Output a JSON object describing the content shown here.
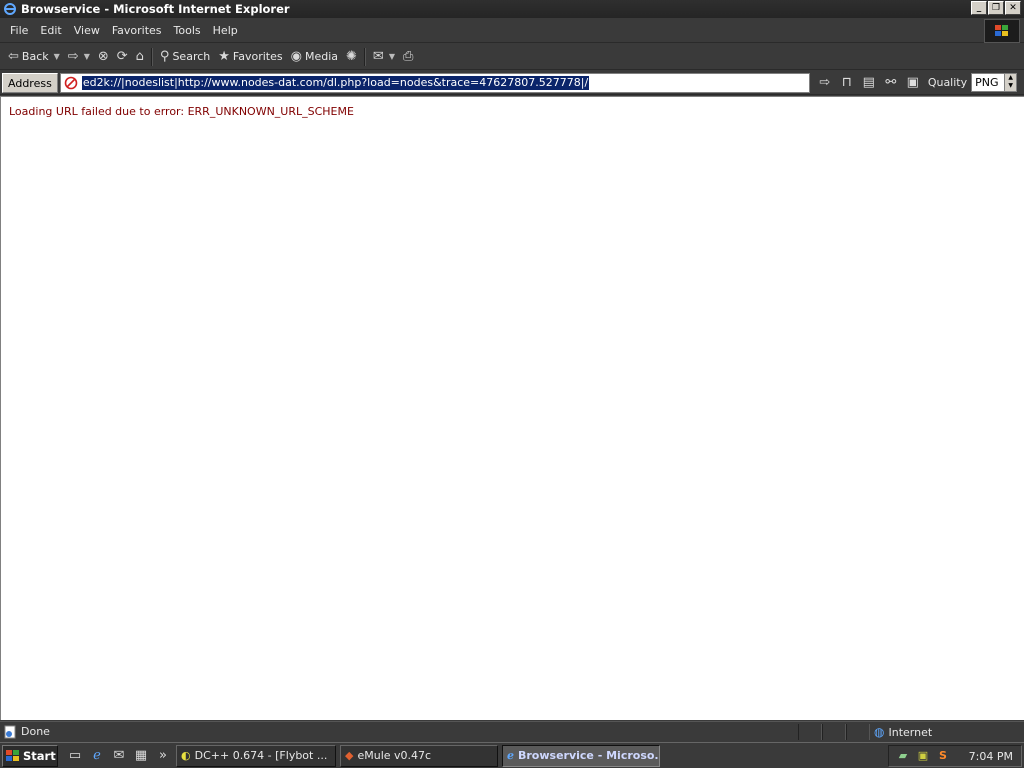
{
  "window": {
    "title": "Browservice - Microsoft Internet Explorer",
    "controls": [
      "_",
      "❐",
      "✕"
    ]
  },
  "menubar": {
    "items": [
      "File",
      "Edit",
      "View",
      "Favorites",
      "Tools",
      "Help"
    ]
  },
  "toolbar": {
    "back_label": "Back",
    "search_label": "Search",
    "favorites_label": "Favorites",
    "media_label": "Media"
  },
  "address": {
    "label": "Address",
    "url": "ed2k://|nodeslist|http://www.nodes-dat.com/dl.php?load=nodes&trace=47627807.527778|/",
    "quality_label": "Quality",
    "quality_value": "PNG"
  },
  "content": {
    "error_message": "Loading URL failed due to error: ERR_UNKNOWN_URL_SCHEME"
  },
  "statusbar": {
    "status_text": "Done",
    "zone": "Internet"
  },
  "taskbar": {
    "start_label": "Start",
    "overflow": "»",
    "tasks": [
      {
        "label": "DC++ 0.674 - [Flybot       ..."
      },
      {
        "label": "eMule v0.47c"
      },
      {
        "label": "Browservice - Microso..."
      }
    ],
    "clock": "7:04 PM"
  },
  "colors": {
    "chrome_bg": "#3a3a3a",
    "url_selection": "#0a246a",
    "error_text": "#800000"
  }
}
